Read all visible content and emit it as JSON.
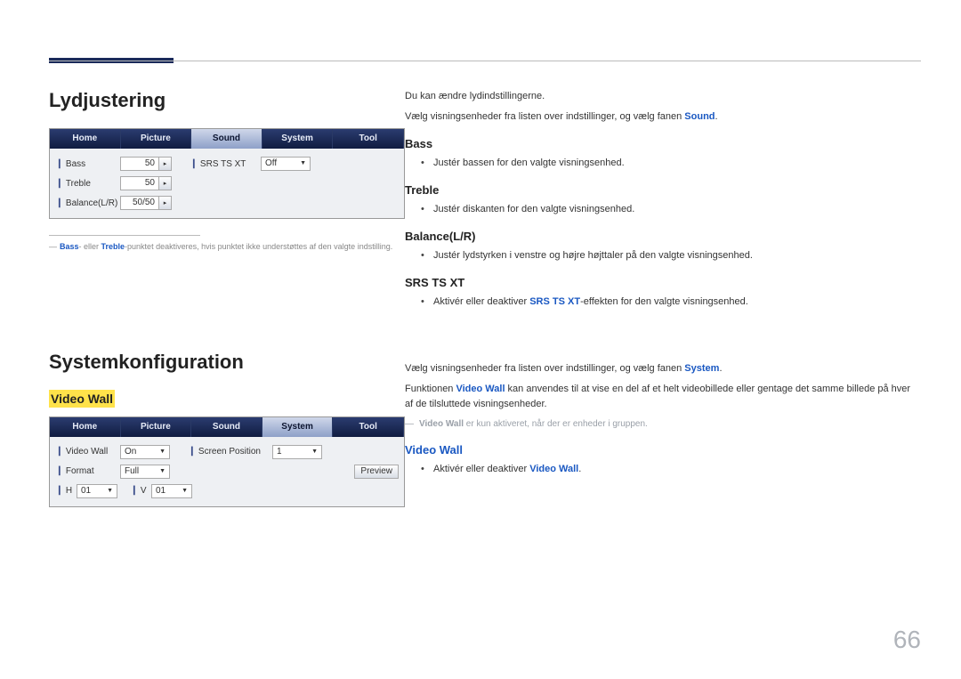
{
  "page_number": "66",
  "left": {
    "section1_title": "Lydjustering",
    "sound_panel": {
      "tabs": [
        "Home",
        "Picture",
        "Sound",
        "System",
        "Tool"
      ],
      "active_tab_index": 2,
      "rows": {
        "bass_label": "Bass",
        "bass_value": "50",
        "treble_label": "Treble",
        "treble_value": "50",
        "balance_label": "Balance(L/R)",
        "balance_value": "50/50",
        "srs_label": "SRS TS XT",
        "srs_value": "Off"
      }
    },
    "footnote_prefix": "―",
    "footnote_bass": "Bass",
    "footnote_mid1": "- eller ",
    "footnote_treble": "Treble",
    "footnote_rest": "-punktet deaktiveres, hvis punktet ikke understøttes af den valgte indstilling.",
    "section2_title": "Systemkonfiguration",
    "videowall_label": "Video Wall",
    "system_panel": {
      "tabs": [
        "Home",
        "Picture",
        "Sound",
        "System",
        "Tool"
      ],
      "active_tab_index": 3,
      "rows": {
        "videowall_label": "Video Wall",
        "videowall_value": "On",
        "format_label": "Format",
        "format_value": "Full",
        "h_label": "H",
        "h_value": "01",
        "v_label": "V",
        "v_value": "01",
        "screenpos_label": "Screen Position",
        "screenpos_value": "1",
        "preview_label": "Preview"
      }
    }
  },
  "right": {
    "intro1": "Du kan ændre lydindstillingerne.",
    "intro2_a": "Vælg visningsenheder fra listen over indstillinger, og vælg fanen ",
    "intro2_kw": "Sound",
    "intro2_b": ".",
    "bass_h": "Bass",
    "bass_li": "Justér bassen for den valgte visningsenhed.",
    "treble_h": "Treble",
    "treble_li": "Justér diskanten for den valgte visningsenhed.",
    "balance_h": "Balance(L/R)",
    "balance_li": "Justér lydstyrken i venstre og højre højttaler på den valgte visningsenhed.",
    "srs_h": "SRS TS XT",
    "srs_li_a": "Aktivér eller deaktiver ",
    "srs_li_kw": "SRS TS XT",
    "srs_li_b": "-effekten for den valgte visningsenhed.",
    "sys_intro_a": "Vælg visningsenheder fra listen over indstillinger, og vælg fanen ",
    "sys_intro_kw": "System",
    "sys_intro_b": ".",
    "sys_desc_a": "Funktionen ",
    "sys_desc_kw": "Video Wall",
    "sys_desc_b": " kan anvendes til at vise en del af et helt videobillede eller gentage det samme billede på hver af de tilsluttede visningsenheder.",
    "sys_note_dash": "―",
    "sys_note_kw": "Video Wall",
    "sys_note_b": " er kun aktiveret, når der er enheder i gruppen.",
    "vw_h": "Video Wall",
    "vw_li_a": "Aktivér eller deaktiver ",
    "vw_li_kw": "Video Wall",
    "vw_li_b": "."
  }
}
